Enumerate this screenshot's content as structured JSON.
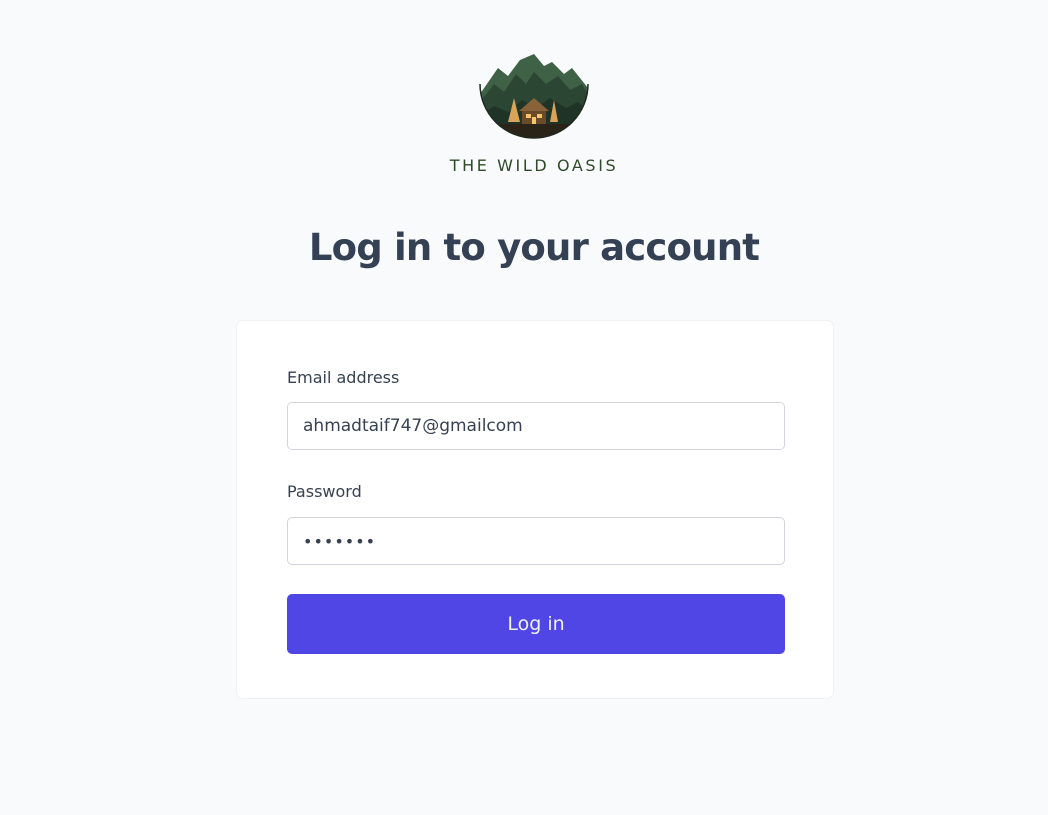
{
  "brand": {
    "name": "THE WILD OASIS"
  },
  "login": {
    "title": "Log in to your account",
    "email_label": "Email address",
    "email_value": "ahmadtaif747@gmailcom",
    "password_label": "Password",
    "password_mask": "•••••••",
    "submit_label": "Log in"
  },
  "colors": {
    "background": "#f9fafb",
    "card": "#ffffff",
    "primary_button": "#4f46e5",
    "heading": "#344054",
    "brand_text": "#2f4a2a"
  },
  "icons": {
    "logo": "mountain-cabin-logo-icon"
  }
}
